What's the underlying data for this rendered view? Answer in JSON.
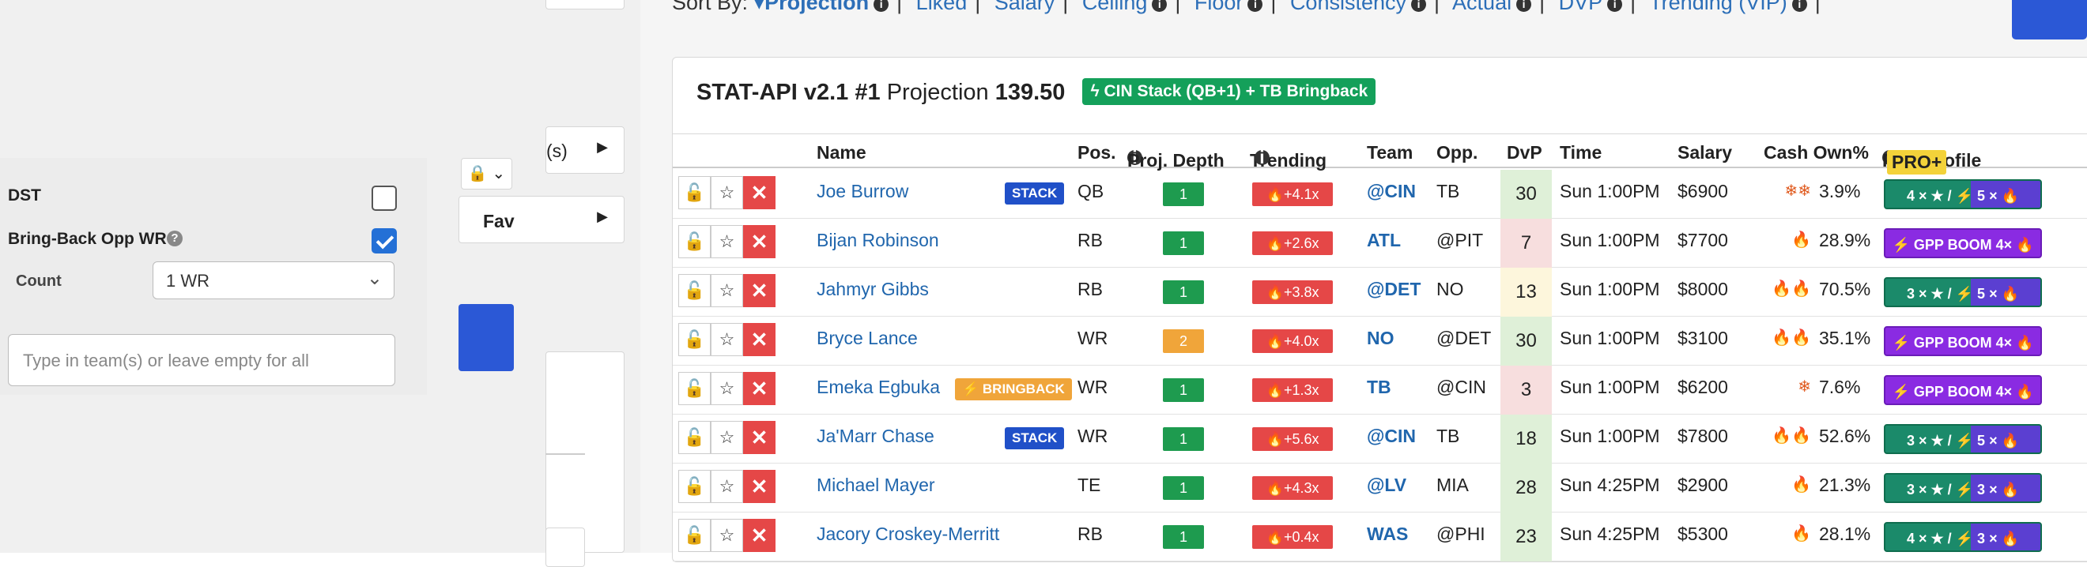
{
  "sort": {
    "label": "Sort By:",
    "active": "Projection",
    "options": [
      "Liked",
      "Salary",
      "Ceiling",
      "Floor",
      "Consistency",
      "Actual",
      "DVP",
      "Trending (VIP)"
    ]
  },
  "filters": {
    "dst_label": "DST",
    "bringback_label": "Bring-Back Opp WR",
    "count_label": "Count",
    "count_value": "1 WR",
    "team_placeholder": "Type in team(s) or leave empty for all",
    "partial_s": "(s)",
    "partial_fav": "Fav"
  },
  "lineup": {
    "title": "STAT-API v2.1 #1",
    "proj_label": "Projection",
    "proj_value": "139.50",
    "stack_badge": "CIN Stack (QB+1) + TB Bringback"
  },
  "table": {
    "headers": {
      "name": "Name",
      "pos": "Pos.",
      "depth": "Proj. Depth",
      "trending": "Trending",
      "team": "Team",
      "opp": "Opp.",
      "dvp": "DvP",
      "time": "Time",
      "salary": "Salary",
      "cash": "Cash Own%",
      "profile": "Play Profile",
      "pro": "PRO+"
    },
    "rows": [
      {
        "name": "Joe Burrow",
        "tag": "STACK",
        "pos": "QB",
        "depth": "1",
        "trend": "+4.1x",
        "team": "@CIN",
        "opp": "TB",
        "dvp": "30",
        "time": "Sun 1:00PM",
        "salary": "$6900",
        "icon": "❄❄",
        "own": "3.9%",
        "profile": "4 × ★ / ⚡ 5 × 🔥"
      },
      {
        "name": "Bijan Robinson",
        "tag": "",
        "pos": "RB",
        "depth": "1",
        "trend": "+2.6x",
        "team": "ATL",
        "opp": "@PIT",
        "dvp": "7",
        "time": "Sun 1:00PM",
        "salary": "$7700",
        "icon": "🔥",
        "own": "28.9%",
        "profile": "⚡ GPP BOOM 4× 🔥"
      },
      {
        "name": "Jahmyr Gibbs",
        "tag": "",
        "pos": "RB",
        "depth": "1",
        "trend": "+3.8x",
        "team": "@DET",
        "opp": "NO",
        "dvp": "13",
        "time": "Sun 1:00PM",
        "salary": "$8000",
        "icon": "🔥🔥",
        "own": "70.5%",
        "profile": "3 × ★ / ⚡ 5 × 🔥"
      },
      {
        "name": "Bryce Lance",
        "tag": "",
        "pos": "WR",
        "depth": "2",
        "trend": "+4.0x",
        "team": "NO",
        "opp": "@DET",
        "dvp": "30",
        "time": "Sun 1:00PM",
        "salary": "$3100",
        "icon": "🔥🔥",
        "own": "35.1%",
        "profile": "⚡ GPP BOOM 4× 🔥"
      },
      {
        "name": "Emeka Egbuka",
        "tag": "⚡ BRINGBACK",
        "pos": "WR",
        "depth": "1",
        "trend": "+1.3x",
        "team": "TB",
        "opp": "@CIN",
        "dvp": "3",
        "time": "Sun 1:00PM",
        "salary": "$6200",
        "icon": "❄",
        "own": "7.6%",
        "profile": "⚡ GPP BOOM 4× 🔥"
      },
      {
        "name": "Ja'Marr Chase",
        "tag": "STACK",
        "pos": "WR",
        "depth": "1",
        "trend": "+5.6x",
        "team": "@CIN",
        "opp": "TB",
        "dvp": "18",
        "time": "Sun 1:00PM",
        "salary": "$7800",
        "icon": "🔥🔥",
        "own": "52.6%",
        "profile": "3 × ★ / ⚡ 5 × 🔥"
      },
      {
        "name": "Michael Mayer",
        "tag": "",
        "pos": "TE",
        "depth": "1",
        "trend": "+4.3x",
        "team": "@LV",
        "opp": "MIA",
        "dvp": "28",
        "time": "Sun 4:25PM",
        "salary": "$2900",
        "icon": "🔥",
        "own": "21.3%",
        "profile": "3 × ★ / ⚡ 3 × 🔥"
      },
      {
        "name": "Jacory Croskey-Merritt",
        "tag": "",
        "pos": "RB",
        "depth": "1",
        "trend": "+0.4x",
        "team": "WAS",
        "opp": "@PHI",
        "dvp": "23",
        "time": "Sun 4:25PM",
        "salary": "$5300",
        "icon": "🔥",
        "own": "28.1%",
        "profile": "4 × ★ / ⚡ 3 × 🔥"
      }
    ]
  }
}
